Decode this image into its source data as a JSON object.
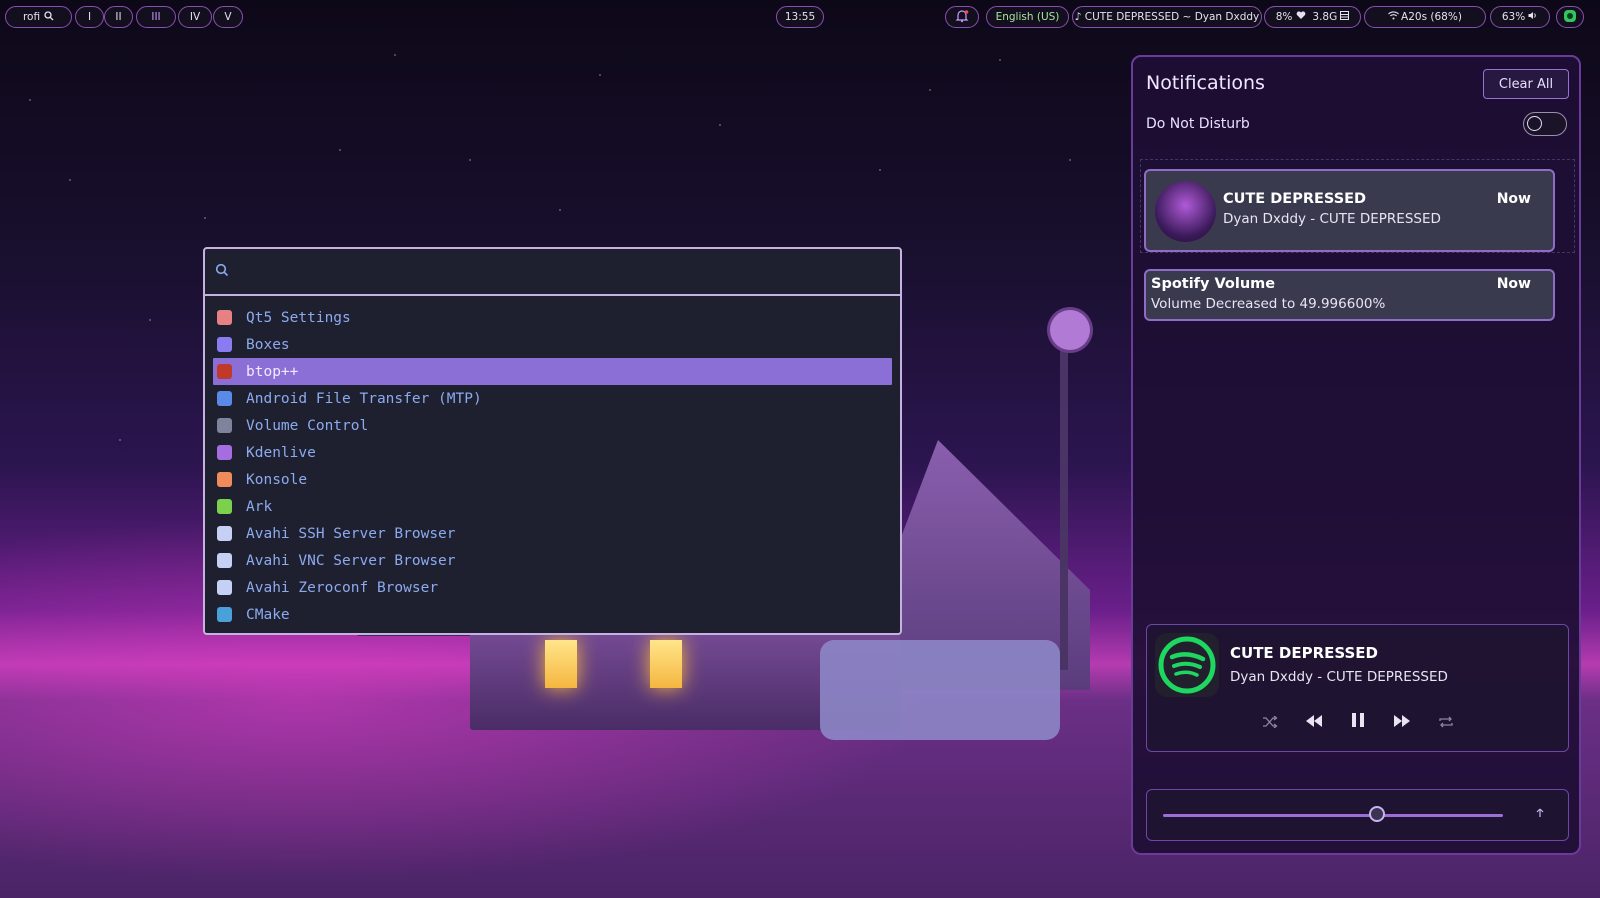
{
  "topbar": {
    "launcher": "rofi",
    "workspaces": [
      "I",
      "II",
      "III",
      "IV",
      "V"
    ],
    "active_workspace": "III",
    "clock": "13:55",
    "keyboard_layout": "English (US)",
    "now_playing": "♪ CUTE DEPRESSED ~ Dyan Dxddy",
    "cpu": "8%",
    "memory": "3.8G",
    "wifi": "A20s (68%)",
    "volume": "63%"
  },
  "rofi": {
    "search_value": "",
    "items": [
      {
        "label": "Qt5 Settings",
        "icon": "qt-settings-icon",
        "color": "#e78284"
      },
      {
        "label": "Boxes",
        "icon": "boxes-icon",
        "color": "#8a7cf0"
      },
      {
        "label": "btop++",
        "icon": "btop-icon",
        "color": "#c0392b"
      },
      {
        "label": "Android File Transfer (MTP)",
        "icon": "android-icon",
        "color": "#5a8ae8"
      },
      {
        "label": "Volume Control",
        "icon": "volume-icon",
        "color": "#7f849c"
      },
      {
        "label": "Kdenlive",
        "icon": "kdenlive-icon",
        "color": "#a66de0"
      },
      {
        "label": "Konsole",
        "icon": "konsole-icon",
        "color": "#f08c5a"
      },
      {
        "label": "Ark",
        "icon": "ark-icon",
        "color": "#7bd04c"
      },
      {
        "label": "Avahi SSH Server Browser",
        "icon": "avahi-icon",
        "color": "#c6d0f5"
      },
      {
        "label": "Avahi VNC Server Browser",
        "icon": "avahi-icon",
        "color": "#c6d0f5"
      },
      {
        "label": "Avahi Zeroconf Browser",
        "icon": "avahi-icon",
        "color": "#c6d0f5"
      },
      {
        "label": "CMake",
        "icon": "cmake-icon",
        "color": "#4aa0d8"
      }
    ],
    "selected_index": 2
  },
  "panel": {
    "title": "Notifications",
    "clear_label": "Clear All",
    "dnd_label": "Do Not Disturb",
    "dnd_enabled": false,
    "notifications": [
      {
        "title": "CUTE DEPRESSED",
        "body": "Dyan Dxddy - CUTE DEPRESSED",
        "time": "Now"
      },
      {
        "title": "Spotify Volume",
        "body": "Volume Decreased to 49.996600%",
        "time": "Now"
      }
    ],
    "player": {
      "title": "CUTE DEPRESSED",
      "subtitle": "Dyan Dxddy - CUTE DEPRESSED"
    },
    "volume_level": 0.63
  },
  "colors": {
    "accent": "#8c6fd6",
    "panel_border": "#6a3c9a",
    "spotify_green": "#1ed760"
  }
}
